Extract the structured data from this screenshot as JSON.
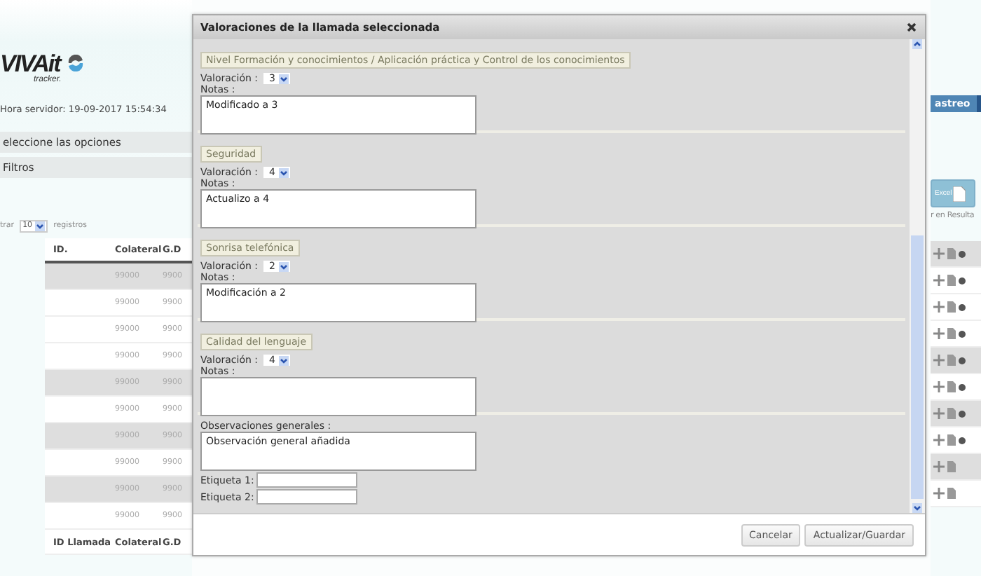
{
  "background_page": {
    "logo": {
      "brand": "VIVAit",
      "sub": "tracker."
    },
    "server_time": "Hora servidor: 19-09-2017 15:54:34",
    "options_title": "eleccione las opciones",
    "filters": "Filtros",
    "page_size": {
      "prefix": "trar",
      "value": "10",
      "suffix": "registros"
    },
    "tab": "astreo",
    "excel_button": "Excel",
    "search_hint": "r en Resulta",
    "table": {
      "columns": [
        "ID.",
        "Colateral",
        "G.D"
      ],
      "rows": [
        {
          "column_2": "99000",
          "column_3": "9900",
          "shaded": true,
          "has_dot": true
        },
        {
          "column_2": "99000",
          "column_3": "9900",
          "shaded": false,
          "has_dot": true
        },
        {
          "column_2": "99000",
          "column_3": "9900",
          "shaded": false,
          "has_dot": true
        },
        {
          "column_2": "99000",
          "column_3": "9900",
          "shaded": false,
          "has_dot": true
        },
        {
          "column_2": "99000",
          "column_3": "9900",
          "shaded": true,
          "has_dot": true
        },
        {
          "column_2": "99000",
          "column_3": "9900",
          "shaded": false,
          "has_dot": true
        },
        {
          "column_2": "99000",
          "column_3": "9900",
          "shaded": true,
          "has_dot": true
        },
        {
          "column_2": "99000",
          "column_3": "9900",
          "shaded": false,
          "has_dot": true
        },
        {
          "column_2": "99000",
          "column_3": "9900",
          "shaded": true,
          "has_dot": false
        },
        {
          "column_2": "99000",
          "column_3": "9900",
          "shaded": false,
          "has_dot": false
        }
      ],
      "footer": [
        "ID Llamada",
        "Colateral",
        "G.D"
      ]
    }
  },
  "dialog": {
    "title": "Valoraciones de la llamada seleccionada",
    "sections": [
      {
        "heading": "Nivel Formación y conocimientos / Aplicación práctica y Control de los conocimientos",
        "rating_label": "Valoración :",
        "rating": "3",
        "notes_label": "Notas :",
        "notes": "Modificado a 3"
      },
      {
        "heading": "Seguridad",
        "rating_label": "Valoración :",
        "rating": "4",
        "notes_label": "Notas :",
        "notes": "Actualizo a 4"
      },
      {
        "heading": "Sonrisa telefónica",
        "rating_label": "Valoración :",
        "rating": "2",
        "notes_label": "Notas :",
        "notes": "Modificación a 2"
      },
      {
        "heading": "Calidad del lenguaje",
        "rating_label": "Valoración :",
        "rating": "4",
        "notes_label": "Notas :"
      }
    ],
    "general": {
      "label": "Observaciones generales :",
      "value": "Observación general añadida"
    },
    "tags": [
      {
        "label": "Etiqueta 1:"
      },
      {
        "label": "Etiqueta 2:"
      }
    ],
    "buttons": [
      "Cancelar",
      "Actualizar/Guardar"
    ]
  }
}
